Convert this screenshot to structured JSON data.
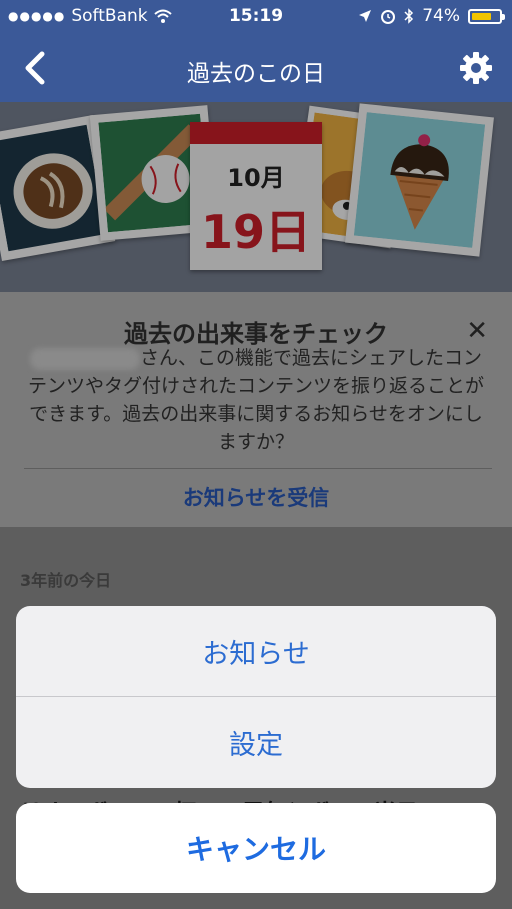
{
  "status_bar": {
    "carrier": "SoftBank",
    "time": "15:19",
    "battery_percent": "74%",
    "battery_level": 0.74
  },
  "nav": {
    "title": "過去のこの日"
  },
  "banner": {
    "month": "10月",
    "day": "19日"
  },
  "card": {
    "title": "過去の出来事をチェック",
    "body": "さん、この機能で過去にシェアしたコンテンツやタグ付けされたコンテンツを振り返ることができます。過去の出来事に関するお知らせをオンにしますか？",
    "action_label": "お知らせを受信"
  },
  "section": {
    "label": "3年前の今日",
    "post_fragment": "リオンボール、杯100周年とボール当日の"
  },
  "action_sheet": {
    "option1": "お知らせ",
    "option2": "設定",
    "cancel": "キャンセル"
  },
  "colors": {
    "facebook_blue": "#3b5998",
    "action_blue": "#2c6cd1",
    "date_red": "#d0202a"
  }
}
